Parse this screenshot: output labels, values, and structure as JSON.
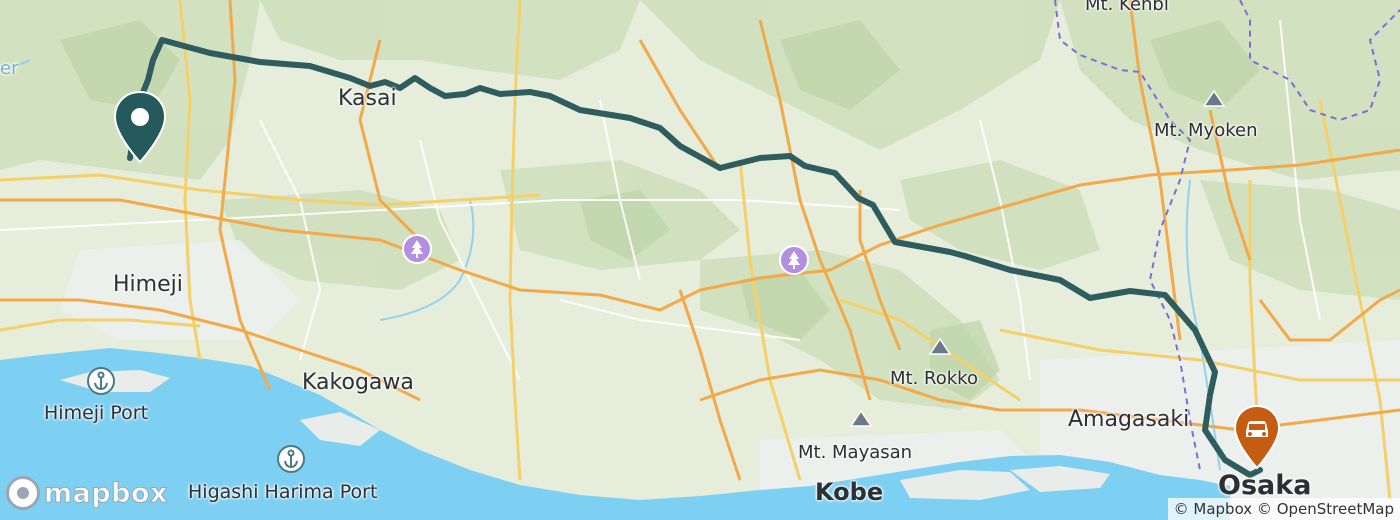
{
  "map": {
    "labels": {
      "kasai": "Kasai",
      "himeji": "Himeji",
      "kakogawa": "Kakogawa",
      "himeji_port": "Himeji Port",
      "higashi_harima_port": "Higashi Harima Port",
      "mt_kenbi": "Mt. Kenbi",
      "mt_myoken": "Mt. Myoken",
      "mt_rokko": "Mt. Rokko",
      "mt_mayasan": "Mt. Mayasan",
      "amagasaki": "Amagasaki",
      "kobe": "Kobe",
      "osaka": "Osaka",
      "edge_fragment": "er"
    },
    "icons": {
      "start_marker": "location-pin-icon",
      "end_marker": "car-pin-icon",
      "park_1": "park-icon",
      "park_2": "park-icon",
      "port_1": "anchor-icon",
      "port_2": "anchor-icon",
      "mountain": "mountain-icon"
    },
    "colors": {
      "route": "#2f5d5f",
      "start_marker": "#255a5c",
      "end_marker": "#c45c12",
      "water": "#7ed0f2",
      "land": "#e6eedb",
      "forest": "#cfe0bd",
      "highway": "#f2a94a",
      "road": "#f5d06a",
      "park_icon": "#b48ee0"
    }
  },
  "branding": {
    "logo_text": "mapbox",
    "attribution": "© Mapbox © OpenStreetMap"
  }
}
